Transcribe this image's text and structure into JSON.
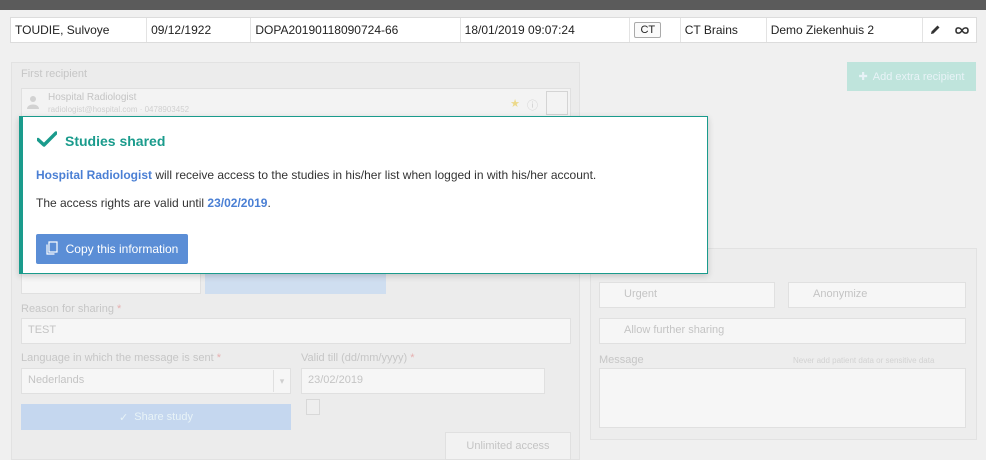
{
  "colors": {
    "accent": "#1a9b8c",
    "link": "#4a7fd4",
    "button": "#5b8ed6"
  },
  "study": {
    "patient_name": "TOUDIE, Sulvoye",
    "birth_date": "09/12/1922",
    "accession": "DOPA20190118090724-66",
    "study_datetime": "18/01/2019 09:07:24",
    "modality": "CT",
    "description": "CT Brains",
    "institution": "Demo Ziekenhuis 2",
    "edit_icon": "pencil-icon",
    "link_icon": "infinity-icon"
  },
  "background": {
    "first_recipient_label": "First recipient",
    "recipient_name": "Hospital Radiologist",
    "recipient_email": "radiologist@hospital.com · 0478903452",
    "add_recipient_label": "Add extra recipient",
    "reason_label": "Reason for sharing",
    "reason_value": "TEST",
    "language_label": "Language in which the message is sent",
    "language_value": "Nederlands",
    "valid_till_label": "Valid till (dd/mm/yyyy)",
    "valid_till_value": "23/02/2019",
    "share_button_label": "Share study",
    "unlimited_access_label": "Unlimited access",
    "urgent_label": "Urgent",
    "anonymize_label": "Anonymize",
    "allow_further_sharing_label": "Allow further sharing",
    "message_label": "Message",
    "message_hint": "Never add patient data or sensitive data"
  },
  "dialog": {
    "title": "Studies shared",
    "recipient": "Hospital Radiologist",
    "line1_rest": " will receive access to the studies in his/her list when logged in with his/her account.",
    "line2_prefix": "The access rights are valid until ",
    "valid_until": "23/02/2019",
    "line2_suffix": ".",
    "copy_button_label": "Copy this information"
  }
}
